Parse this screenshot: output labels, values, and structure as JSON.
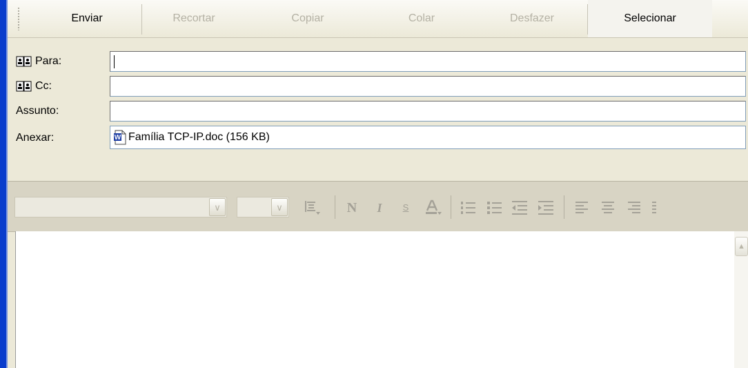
{
  "toolbar": {
    "send": "Enviar",
    "cut": "Recortar",
    "copy": "Copiar",
    "paste": "Colar",
    "undo": "Desfazer",
    "select": "Selecionar"
  },
  "fields": {
    "to_label": "Para:",
    "cc_label": "Cc:",
    "subject_label": "Assunto:",
    "attach_label": "Anexar:",
    "to_value": "",
    "cc_value": "",
    "subject_value": "",
    "attachment": "Família TCP-IP.doc (156 KB)"
  },
  "format_toolbar": {
    "font_value": "",
    "size_value": "",
    "bold": "N",
    "italic": "I",
    "underline": "S",
    "icons": [
      "paragraph-style-icon",
      "bold-icon",
      "italic-icon",
      "underline-icon",
      "font-color-icon",
      "numbered-list-icon",
      "bulleted-list-icon",
      "decrease-indent-icon",
      "increase-indent-icon",
      "align-left-icon",
      "align-center-icon",
      "align-right-icon"
    ]
  },
  "colors": {
    "window_frame": "#0a3dcc",
    "toolbar_bg": "#ece9d8",
    "disabled_text": "#b4b1a4"
  },
  "body": {
    "text": ""
  }
}
